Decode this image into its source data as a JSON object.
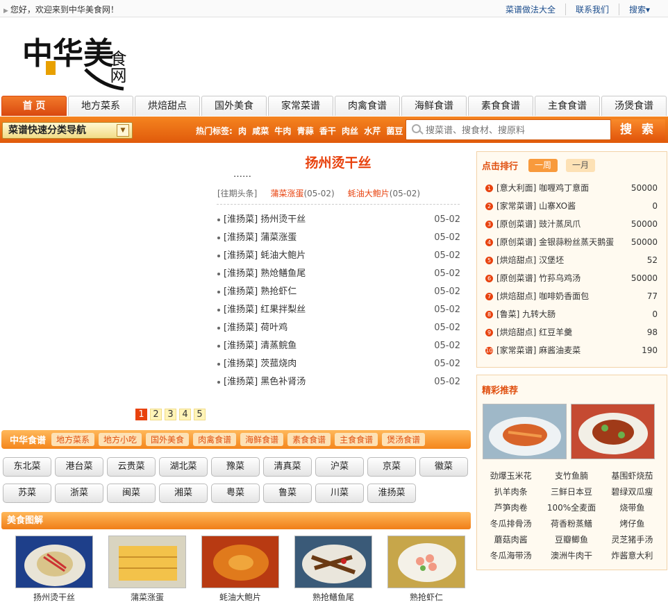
{
  "topbar": {
    "welcome": "您好，欢迎来到中华美食网！",
    "links": [
      "菜谱做法大全",
      "联系我们",
      "搜索▾"
    ]
  },
  "logo": {
    "main": "中华美",
    "side": "食网",
    "seal": "美食"
  },
  "nav": [
    "首 页",
    "地方菜系",
    "烘焙甜点",
    "国外美食",
    "家常菜谱",
    "肉禽食谱",
    "海鲜食谱",
    "素食食谱",
    "主食食谱",
    "汤煲食谱"
  ],
  "search": {
    "quick_nav": "菜谱快速分类导航",
    "hot_label": "热门标签:",
    "hot_tags": [
      "肉",
      "咸菜",
      "牛肉",
      "青蒜",
      "香干",
      "肉丝",
      "水芹",
      "菌豆"
    ],
    "placeholder": "搜菜谱、搜食材、搜原料",
    "button": "搜 索"
  },
  "headline": {
    "title": "扬州烫干丝",
    "ellipsis": "……",
    "past_label": "[往期头条]",
    "past": [
      {
        "title": "蒲菜涨蛋",
        "date": "(05-02)"
      },
      {
        "title": "蚝油大鲍片",
        "date": "(05-02)"
      }
    ]
  },
  "articles": [
    {
      "title": "[淮扬菜] 扬州烫干丝",
      "date": "05-02"
    },
    {
      "title": "[淮扬菜] 蒲菜涨蛋",
      "date": "05-02"
    },
    {
      "title": "[淮扬菜] 蚝油大鲍片",
      "date": "05-02"
    },
    {
      "title": "[淮扬菜] 熟炝鳝鱼尾",
      "date": "05-02"
    },
    {
      "title": "[淮扬菜] 熟抢虾仁",
      "date": "05-02"
    },
    {
      "title": "[淮扬菜] 红果拌梨丝",
      "date": "05-02"
    },
    {
      "title": "[淮扬菜] 荷叶鸡",
      "date": "05-02"
    },
    {
      "title": "[淮扬菜] 清蒸鲩鱼",
      "date": "05-02"
    },
    {
      "title": "[淮扬菜] 茨菰烧肉",
      "date": "05-02"
    },
    {
      "title": "[淮扬菜] 黑色补肾汤",
      "date": "05-02"
    }
  ],
  "pager": [
    "1",
    "2",
    "3",
    "4",
    "5"
  ],
  "shipu": {
    "title": "中华食谱",
    "cats": [
      "地方菜系",
      "地方小吃",
      "国外美食",
      "肉禽食谱",
      "海鲜食谱",
      "素食食谱",
      "主食食谱",
      "煲汤食谱"
    ]
  },
  "regions": [
    "东北菜",
    "港台菜",
    "云贵菜",
    "湖北菜",
    "豫菜",
    "清真菜",
    "沪菜",
    "京菜",
    "徽菜",
    "苏菜",
    "浙菜",
    "闽菜",
    "湘菜",
    "粤菜",
    "鲁菜",
    "川菜",
    "淮扬菜"
  ],
  "tujie": {
    "title": "美食图解",
    "items": [
      "扬州烫干丝",
      "蒲菜涨蛋",
      "蚝油大鲍片",
      "熟抢鳝鱼尾",
      "熟抢虾仁"
    ]
  },
  "rank": {
    "title": "点击排行",
    "tabs": [
      "一周",
      "一月"
    ],
    "items": [
      {
        "no": "1",
        "name": "[意大利面] 咖喱鸡丁意面",
        "count": "50000"
      },
      {
        "no": "2",
        "name": "[家常菜谱] 山寨XO酱",
        "count": "0"
      },
      {
        "no": "3",
        "name": "[原创菜谱] 豉汁蒸凤爪",
        "count": "50000"
      },
      {
        "no": "4",
        "name": "[原创菜谱] 金银蒜粉丝蒸天鹅蛋",
        "count": "50000"
      },
      {
        "no": "5",
        "name": "[烘焙甜点] 汉堡坯",
        "count": "52"
      },
      {
        "no": "6",
        "name": "[原创菜谱] 竹荪乌鸡汤",
        "count": "50000"
      },
      {
        "no": "7",
        "name": "[烘焙甜点] 咖啡奶香面包",
        "count": "77"
      },
      {
        "no": "8",
        "name": "[鲁菜] 九转大肠",
        "count": "0"
      },
      {
        "no": "9",
        "name": "[烘焙甜点] 红豆羊羹",
        "count": "98"
      },
      {
        "no": "10",
        "name": "[家常菜谱] 麻酱油麦菜",
        "count": "190"
      }
    ]
  },
  "recommend": {
    "title": "精彩推荐",
    "names": [
      "劲爆玉米花",
      "支竹鱼腩",
      "基围虾烧茄",
      "扒羊肉条",
      "三鲜日本豆",
      "碧绿双瓜瘦",
      "芦笋肉卷",
      "100%全麦面",
      "烧带鱼",
      "冬瓜排骨汤",
      "荷香粉蒸鳝",
      "烤仔鱼",
      "蘑菇肉酱",
      "豆瓣鲫鱼",
      "灵芝猪手汤",
      "冬瓜海带汤",
      "澳洲牛肉干",
      "炸酱意大利"
    ]
  },
  "colors": {
    "accent": "#e8420e",
    "bar": "#f5841f",
    "link": "#1a4c8c"
  }
}
